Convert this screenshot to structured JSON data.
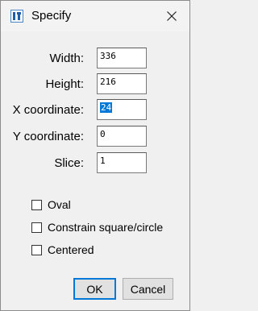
{
  "window": {
    "title": "Specify",
    "icon": "imagej-app-icon",
    "close_icon": "close-icon"
  },
  "fields": [
    {
      "label": "Width:",
      "value": "336"
    },
    {
      "label": "Height:",
      "value": "216"
    },
    {
      "label": "X coordinate:",
      "value": "24",
      "selected": true
    },
    {
      "label": "Y coordinate:",
      "value": "0"
    },
    {
      "label": "Slice:",
      "value": "1"
    }
  ],
  "checkboxes": [
    {
      "label": "Oval",
      "checked": false
    },
    {
      "label": "Constrain square/circle",
      "checked": false
    },
    {
      "label": "Centered",
      "checked": false
    }
  ],
  "buttons": {
    "ok": "OK",
    "cancel": "Cancel"
  },
  "colors": {
    "selection": "#0078d7",
    "default_button_border": "#0078d7"
  }
}
